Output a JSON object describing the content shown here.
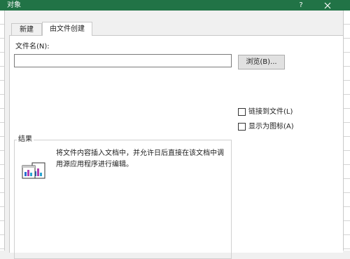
{
  "window": {
    "title": "对象",
    "help_label": "?",
    "close_icon": "close-icon",
    "titlebar_color": "#217346"
  },
  "tabs": [
    {
      "label": "新建",
      "selected": false
    },
    {
      "label": "由文件创建",
      "selected": true
    }
  ],
  "form": {
    "filename_label": "文件名(N):",
    "filename_value": "",
    "browse_label": "浏览(B)..."
  },
  "options": {
    "link_to_file": {
      "label": "链接到文件(L)",
      "checked": false
    },
    "display_as_icon": {
      "label": "显示为图标(A)",
      "checked": false
    }
  },
  "result": {
    "legend": "结果",
    "icon": "embedded-object-icon",
    "text": "将文件内容插入文档中，并允许日后直接在该文档中调用源应用程序进行编辑。"
  }
}
